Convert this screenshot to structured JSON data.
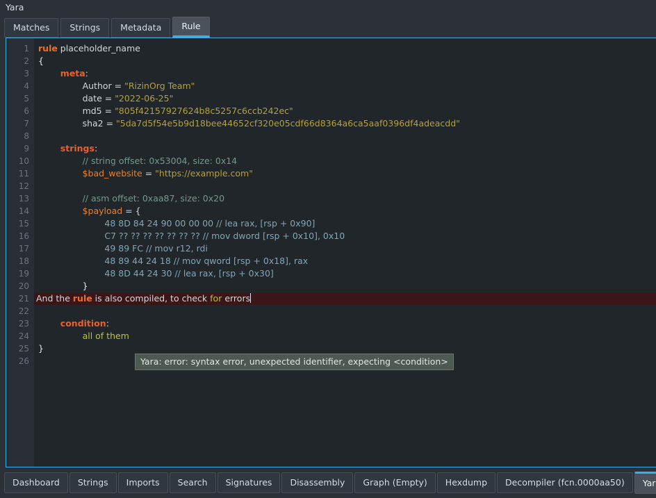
{
  "panel": {
    "title": "Yara"
  },
  "top_tabs": [
    {
      "label": "Matches",
      "active": false
    },
    {
      "label": "Strings",
      "active": false
    },
    {
      "label": "Metadata",
      "active": false
    },
    {
      "label": "Rule",
      "active": true
    }
  ],
  "editor": {
    "line_numbers": [
      1,
      2,
      3,
      4,
      5,
      6,
      7,
      8,
      9,
      10,
      11,
      12,
      13,
      14,
      15,
      16,
      17,
      18,
      19,
      20,
      21,
      22,
      23,
      24,
      25,
      26
    ],
    "lines": [
      {
        "n": 1,
        "error": false,
        "tokens": [
          {
            "t": "kw",
            "s": "rule"
          },
          {
            "t": "plain",
            "s": " placeholder_name"
          }
        ]
      },
      {
        "n": 2,
        "error": false,
        "tokens": [
          {
            "t": "brace",
            "s": "{"
          }
        ]
      },
      {
        "n": 3,
        "error": false,
        "tokens": [
          {
            "t": "plain",
            "s": "        "
          },
          {
            "t": "sec",
            "s": "meta"
          },
          {
            "t": "plain",
            "s": ":"
          }
        ]
      },
      {
        "n": 4,
        "error": false,
        "tokens": [
          {
            "t": "plain",
            "s": "                Author = "
          },
          {
            "t": "str",
            "s": "\"RizinOrg Team\""
          }
        ]
      },
      {
        "n": 5,
        "error": false,
        "tokens": [
          {
            "t": "plain",
            "s": "                date = "
          },
          {
            "t": "str",
            "s": "\"2022-06-25\""
          }
        ]
      },
      {
        "n": 6,
        "error": false,
        "tokens": [
          {
            "t": "plain",
            "s": "                md5 = "
          },
          {
            "t": "str",
            "s": "\"805f42157927624b8c5257c6ccb242ec\""
          }
        ]
      },
      {
        "n": 7,
        "error": false,
        "tokens": [
          {
            "t": "plain",
            "s": "                sha2 = "
          },
          {
            "t": "str",
            "s": "\"5da7d5f54e5b9d18bee44652cf320e05cdf66d8364a6ca5aaf0396df4adeacdd\""
          }
        ]
      },
      {
        "n": 8,
        "error": false,
        "tokens": [
          {
            "t": "plain",
            "s": ""
          }
        ]
      },
      {
        "n": 9,
        "error": false,
        "tokens": [
          {
            "t": "plain",
            "s": "        "
          },
          {
            "t": "sec",
            "s": "strings"
          },
          {
            "t": "plain",
            "s": ":"
          }
        ]
      },
      {
        "n": 10,
        "error": false,
        "tokens": [
          {
            "t": "plain",
            "s": "                "
          },
          {
            "t": "cmt",
            "s": "// string offset: 0x53004, size: 0x14"
          }
        ]
      },
      {
        "n": 11,
        "error": false,
        "tokens": [
          {
            "t": "plain",
            "s": "                "
          },
          {
            "t": "var",
            "s": "$bad_website"
          },
          {
            "t": "plain",
            "s": " = "
          },
          {
            "t": "str",
            "s": "\"https://example.com\""
          }
        ]
      },
      {
        "n": 12,
        "error": false,
        "tokens": [
          {
            "t": "plain",
            "s": ""
          }
        ]
      },
      {
        "n": 13,
        "error": false,
        "tokens": [
          {
            "t": "plain",
            "s": "                "
          },
          {
            "t": "cmt",
            "s": "// asm offset: 0xaa87, size: 0x20"
          }
        ]
      },
      {
        "n": 14,
        "error": false,
        "tokens": [
          {
            "t": "plain",
            "s": "                "
          },
          {
            "t": "var",
            "s": "$payload"
          },
          {
            "t": "plain",
            "s": " = {"
          }
        ]
      },
      {
        "n": 15,
        "error": false,
        "tokens": [
          {
            "t": "plain",
            "s": "                        "
          },
          {
            "t": "hex",
            "s": "48 8D 84 24 90 00 00 00 // lea rax, [rsp + 0x90]"
          }
        ]
      },
      {
        "n": 16,
        "error": false,
        "tokens": [
          {
            "t": "plain",
            "s": "                        "
          },
          {
            "t": "hex",
            "s": "C7 ?? ?? ?? ?? ?? ?? ?? // mov dword [rsp + 0x10], 0x10"
          }
        ]
      },
      {
        "n": 17,
        "error": false,
        "tokens": [
          {
            "t": "plain",
            "s": "                        "
          },
          {
            "t": "hex",
            "s": "49 89 FC // mov r12, rdi"
          }
        ]
      },
      {
        "n": 18,
        "error": false,
        "tokens": [
          {
            "t": "plain",
            "s": "                        "
          },
          {
            "t": "hex",
            "s": "48 89 44 24 18 // mov qword [rsp + 0x18], rax"
          }
        ]
      },
      {
        "n": 19,
        "error": false,
        "tokens": [
          {
            "t": "plain",
            "s": "                        "
          },
          {
            "t": "hex",
            "s": "48 8D 44 24 30 // lea rax, [rsp + 0x30]"
          }
        ]
      },
      {
        "n": 20,
        "error": false,
        "tokens": [
          {
            "t": "plain",
            "s": "                "
          },
          {
            "t": "brace",
            "s": "}"
          }
        ]
      },
      {
        "n": 21,
        "error": true,
        "caret": true,
        "tokens": [
          {
            "t": "plain",
            "s": "And the "
          },
          {
            "t": "kw",
            "s": "rule"
          },
          {
            "t": "plain",
            "s": " is also compiled, to check "
          },
          {
            "t": "cond",
            "s": "for"
          },
          {
            "t": "plain",
            "s": " errors"
          }
        ]
      },
      {
        "n": 22,
        "error": false,
        "tokens": [
          {
            "t": "plain",
            "s": ""
          }
        ]
      },
      {
        "n": 23,
        "error": false,
        "tokens": [
          {
            "t": "plain",
            "s": "        "
          },
          {
            "t": "sec",
            "s": "condition"
          },
          {
            "t": "plain",
            "s": ":"
          }
        ]
      },
      {
        "n": 24,
        "error": false,
        "tokens": [
          {
            "t": "plain",
            "s": "                "
          },
          {
            "t": "cond",
            "s": "all of them"
          }
        ]
      },
      {
        "n": 25,
        "error": false,
        "tokens": [
          {
            "t": "brace",
            "s": "}"
          }
        ]
      },
      {
        "n": 26,
        "error": false,
        "tokens": [
          {
            "t": "plain",
            "s": ""
          }
        ]
      }
    ]
  },
  "tooltip": {
    "text": "Yara: error: syntax error, unexpected identifier, expecting <condition>"
  },
  "bottom_tabs": [
    {
      "label": "Dashboard",
      "active": false
    },
    {
      "label": "Strings",
      "active": false
    },
    {
      "label": "Imports",
      "active": false
    },
    {
      "label": "Search",
      "active": false
    },
    {
      "label": "Signatures",
      "active": false
    },
    {
      "label": "Disassembly",
      "active": false
    },
    {
      "label": "Graph (Empty)",
      "active": false
    },
    {
      "label": "Hexdump",
      "active": false
    },
    {
      "label": "Decompiler (fcn.0000aa50)",
      "active": false
    },
    {
      "label": "Yara",
      "active": true
    }
  ],
  "colors": {
    "window_bg": "#2b3137",
    "editor_bg": "#21262b",
    "gutter_bg": "#282e34",
    "accent_blue": "#3daee9",
    "keyword": "#e8722a",
    "section": "#e8602c",
    "variable": "#e8802e",
    "string": "#b5a03b",
    "comment": "#6f9c88",
    "hex_bytes": "#7fa7b9",
    "condition": "#b9c23c",
    "error_line_bg": "#3b1619",
    "tooltip_bg": "#4d5a52"
  }
}
